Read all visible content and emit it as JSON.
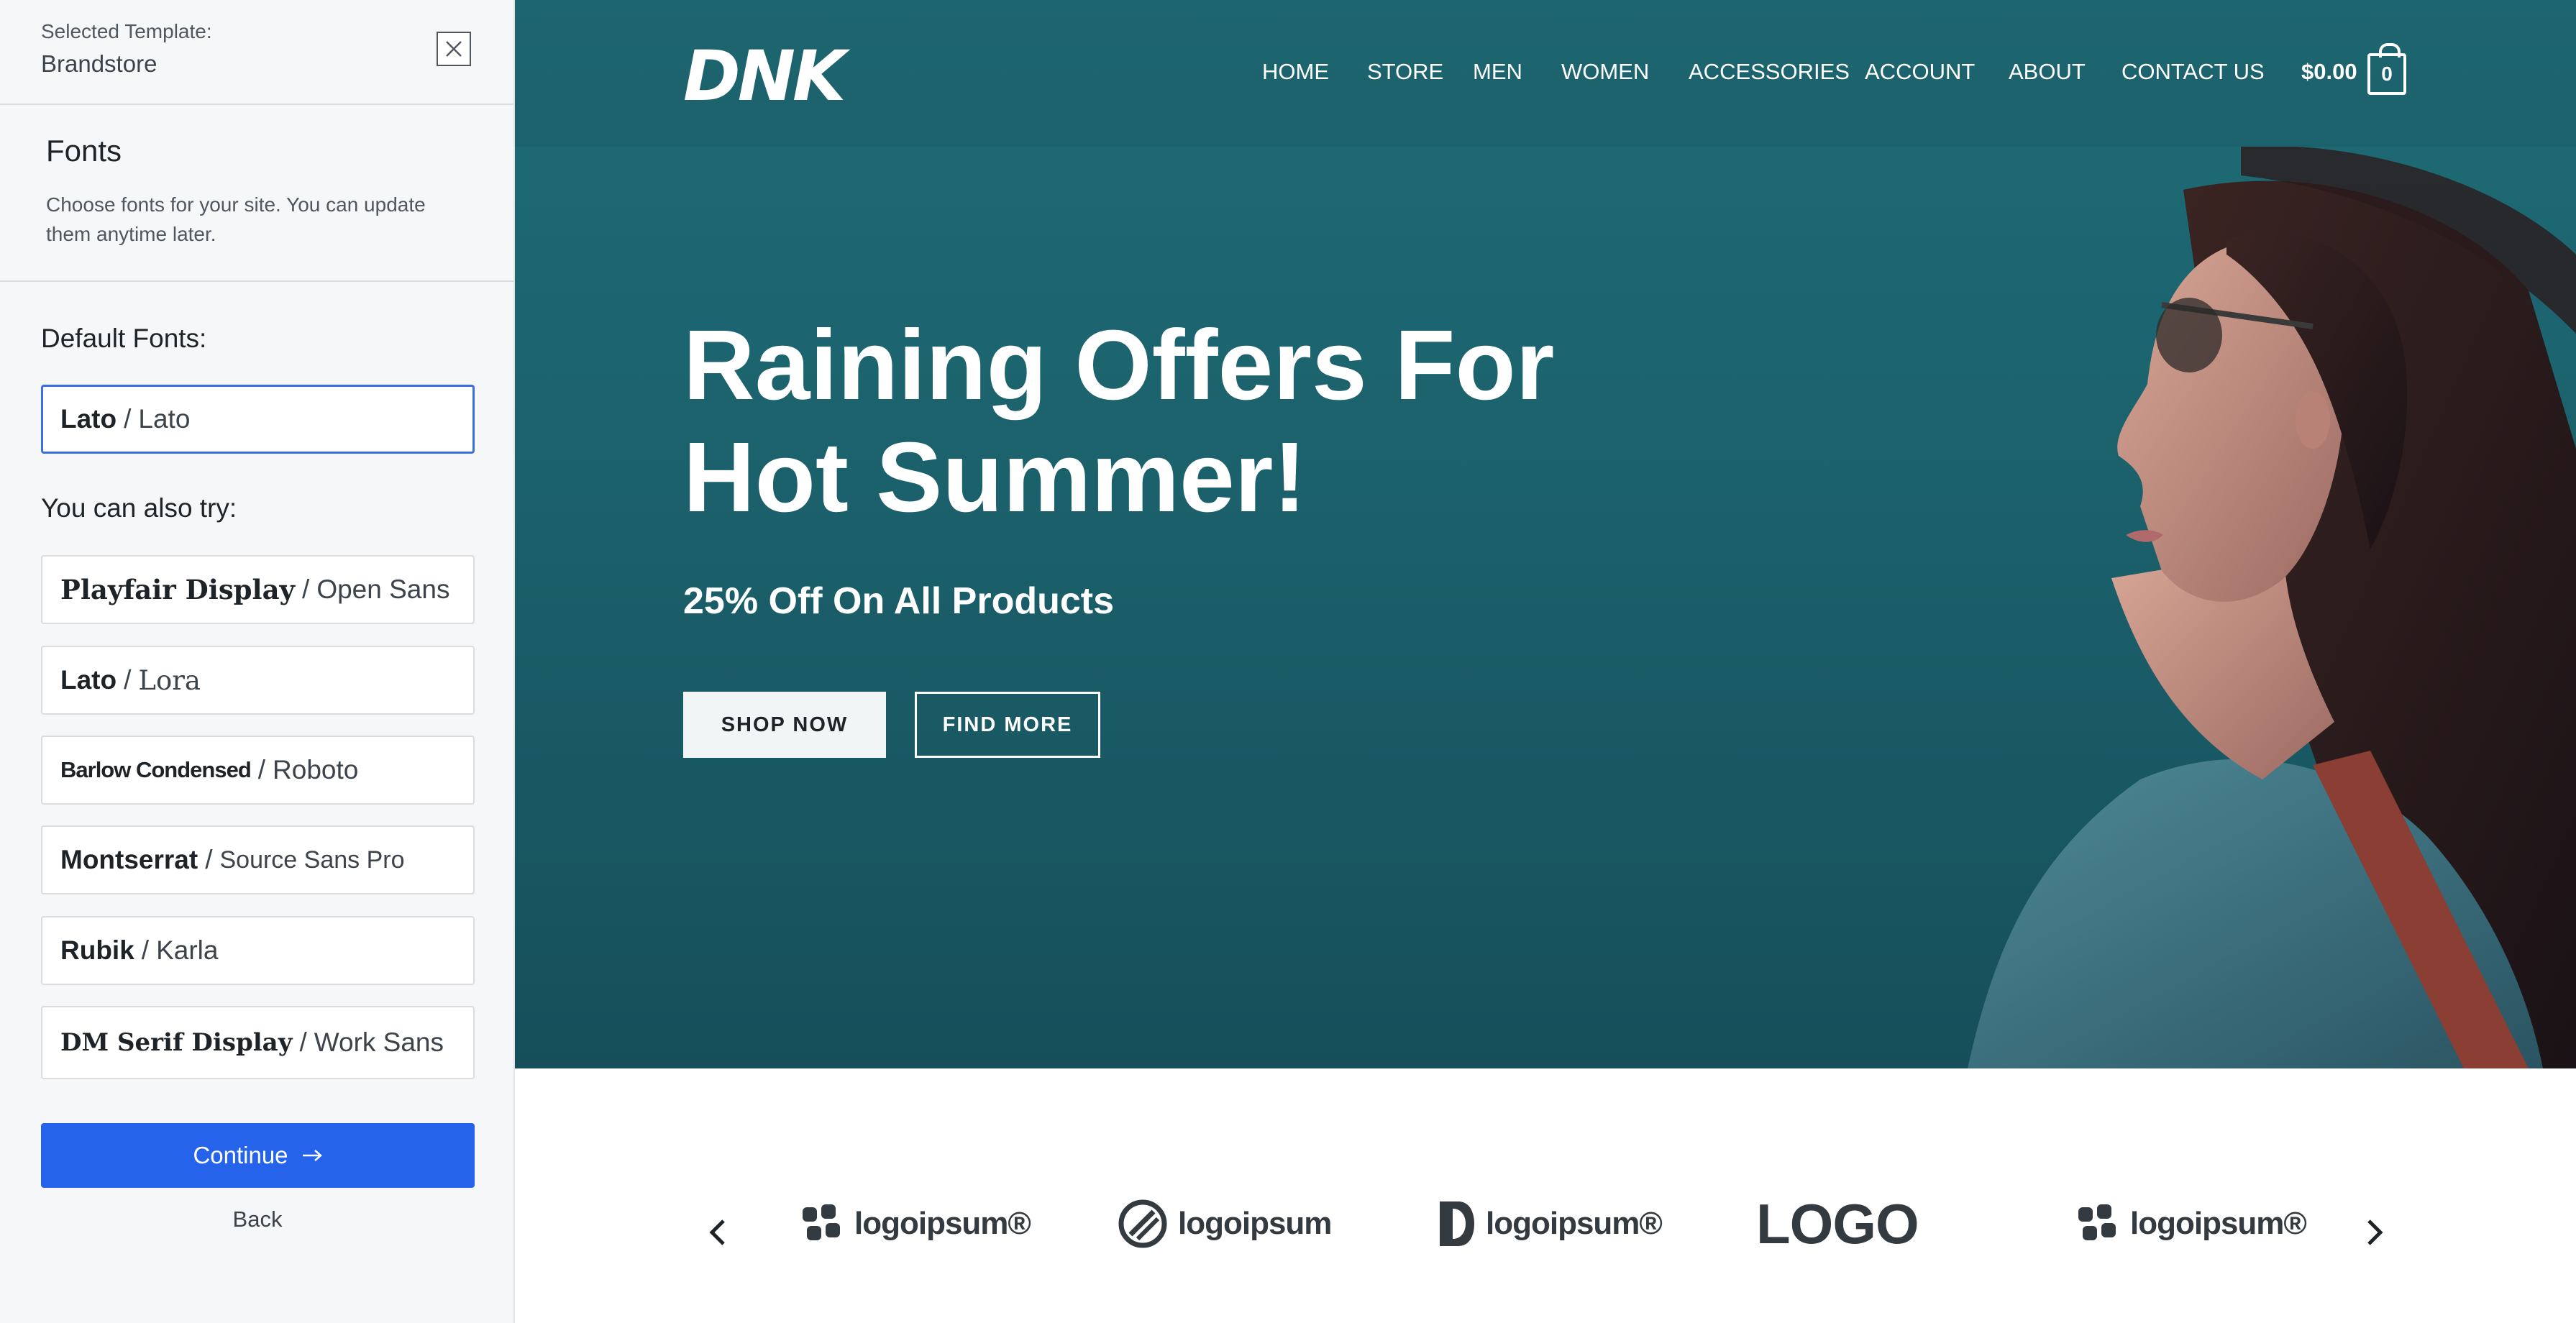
{
  "sidebar": {
    "template_label": "Selected Template:",
    "template_name": "Brandstore",
    "section_title": "Fonts",
    "section_description": "Choose fonts for your site. You can update them anytime later.",
    "default_label": "Default Fonts:",
    "default_font": {
      "heading": "Lato",
      "separator": "/",
      "body": "Lato"
    },
    "try_label": "You can also try:",
    "font_options": [
      {
        "heading": "Playfair Display",
        "separator": "/",
        "body": "Open Sans"
      },
      {
        "heading": "Lato",
        "separator": "/",
        "body": "Lora"
      },
      {
        "heading": "Barlow Condensed",
        "separator": "/",
        "body": "Roboto"
      },
      {
        "heading": "Montserrat",
        "separator": "/",
        "body": "Source Sans Pro"
      },
      {
        "heading": "Rubik",
        "separator": "/",
        "body": "Karla"
      },
      {
        "heading": "DM Serif Display",
        "separator": "/",
        "body": "Work Sans"
      }
    ],
    "continue_label": "Continue",
    "back_label": "Back"
  },
  "preview": {
    "logo": "DNK",
    "nav": [
      "HOME",
      "STORE",
      "MEN",
      "WOMEN",
      "ACCESSORIES",
      "ACCOUNT",
      "ABOUT",
      "CONTACT US"
    ],
    "cart_total": "$0.00",
    "cart_count": "0",
    "hero_title_line1": "Raining Offers For",
    "hero_title_line2": "Hot Summer!",
    "hero_subtitle": "25% Off On All Products",
    "shop_now_label": "SHOP NOW",
    "find_more_label": "FIND MORE",
    "brand_logos": [
      "logoipsum®",
      "logoipsum",
      "logoipsum®",
      "LOGO",
      "logoipsum®"
    ]
  },
  "colors": {
    "accent": "#2563eb",
    "hero_bg": "#1b616c",
    "selected_border": "#3b6fe0"
  },
  "icons": [
    "close-icon",
    "chevron-left-icon",
    "arrow-right-icon",
    "cart-icon",
    "arrow-left-icon"
  ]
}
